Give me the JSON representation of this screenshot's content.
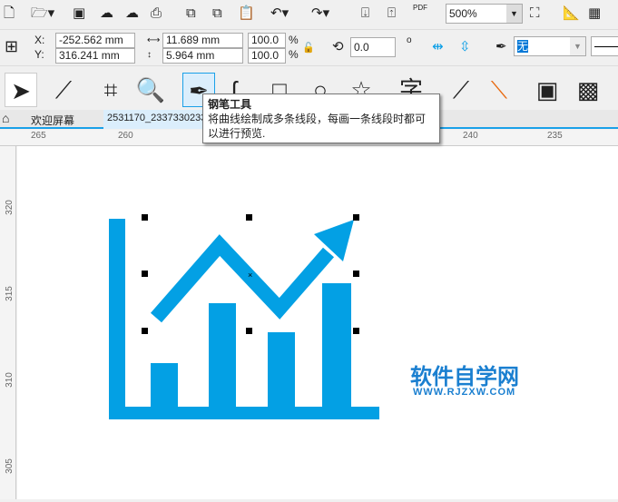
{
  "toolbar": {
    "zoom": "500%",
    "pdf": "PDF"
  },
  "props": {
    "x_label": "X:",
    "y_label": "Y:",
    "x": "-252.562 mm",
    "y": "316.241 mm",
    "width": "11.689 mm",
    "height": "5.964 mm",
    "scale_w": "100.0",
    "scale_h": "100.0",
    "pct": "%",
    "rotation": "0.0",
    "degree": "o",
    "outline": "无"
  },
  "tooltip": {
    "title": "钢笔工具",
    "text": "将曲线绘制成多条线段，每画一条线段时都可以进行预览."
  },
  "tabs": {
    "home": "欢迎屏幕",
    "doc": "2531170_2337330233"
  },
  "ruler": {
    "top": [
      "265",
      "260",
      "240",
      "235"
    ],
    "left": [
      "320",
      "315",
      "310",
      "305"
    ]
  },
  "watermark": {
    "title": "软件自学网",
    "url": "WWW.RJZXW.COM"
  },
  "colors": {
    "accent": "#0a9ee6",
    "graphic": "#03a0e4"
  }
}
